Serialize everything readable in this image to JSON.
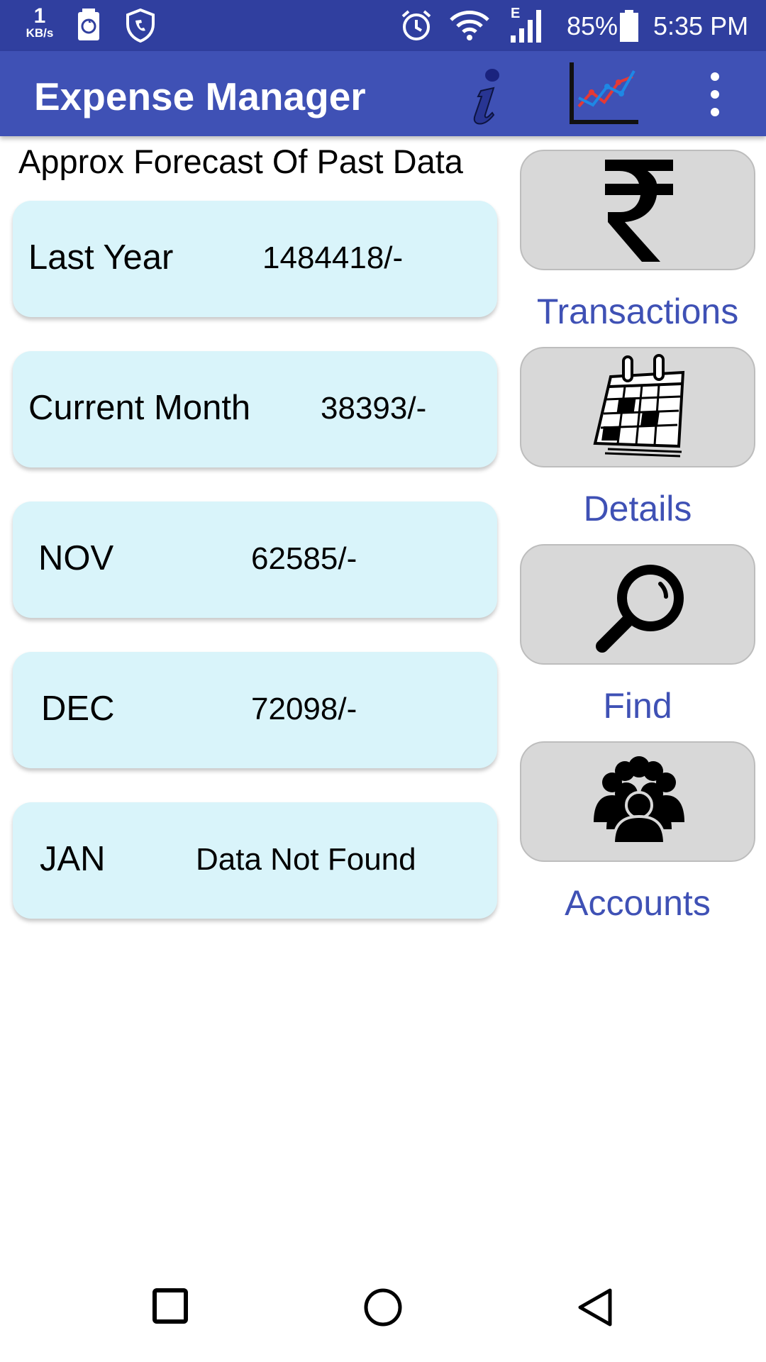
{
  "status_bar": {
    "speed_value": "1",
    "speed_unit": "KB/s",
    "network": "E",
    "battery": "85%",
    "time": "5:35 PM"
  },
  "app_bar": {
    "title": "Expense Manager",
    "icons": [
      "info-icon",
      "chart-icon",
      "overflow-menu-icon"
    ]
  },
  "forecast": {
    "heading": "Approx Forecast Of Past Data",
    "cards": [
      {
        "label": "Last Year",
        "value": "1484418/-"
      },
      {
        "label": "Current Month",
        "value": "38393/-"
      },
      {
        "label": "NOV",
        "value": "62585/-"
      },
      {
        "label": "DEC",
        "value": "72098/-"
      },
      {
        "label": "JAN",
        "value": "Data Not Found"
      }
    ]
  },
  "actions": [
    {
      "label": "Transactions",
      "icon": "rupee-icon"
    },
    {
      "label": "Details",
      "icon": "calendar-icon"
    },
    {
      "label": "Find",
      "icon": "search-icon"
    },
    {
      "label": "Accounts",
      "icon": "people-icon"
    }
  ],
  "colors": {
    "status_bar": "#303f9f",
    "app_bar": "#3f51b5",
    "card_bg": "#d9f4fa",
    "button_bg": "#d8d8d8",
    "accent_text": "#3f51b5"
  },
  "nav_bar": [
    "recents-button",
    "home-button",
    "back-button"
  ]
}
